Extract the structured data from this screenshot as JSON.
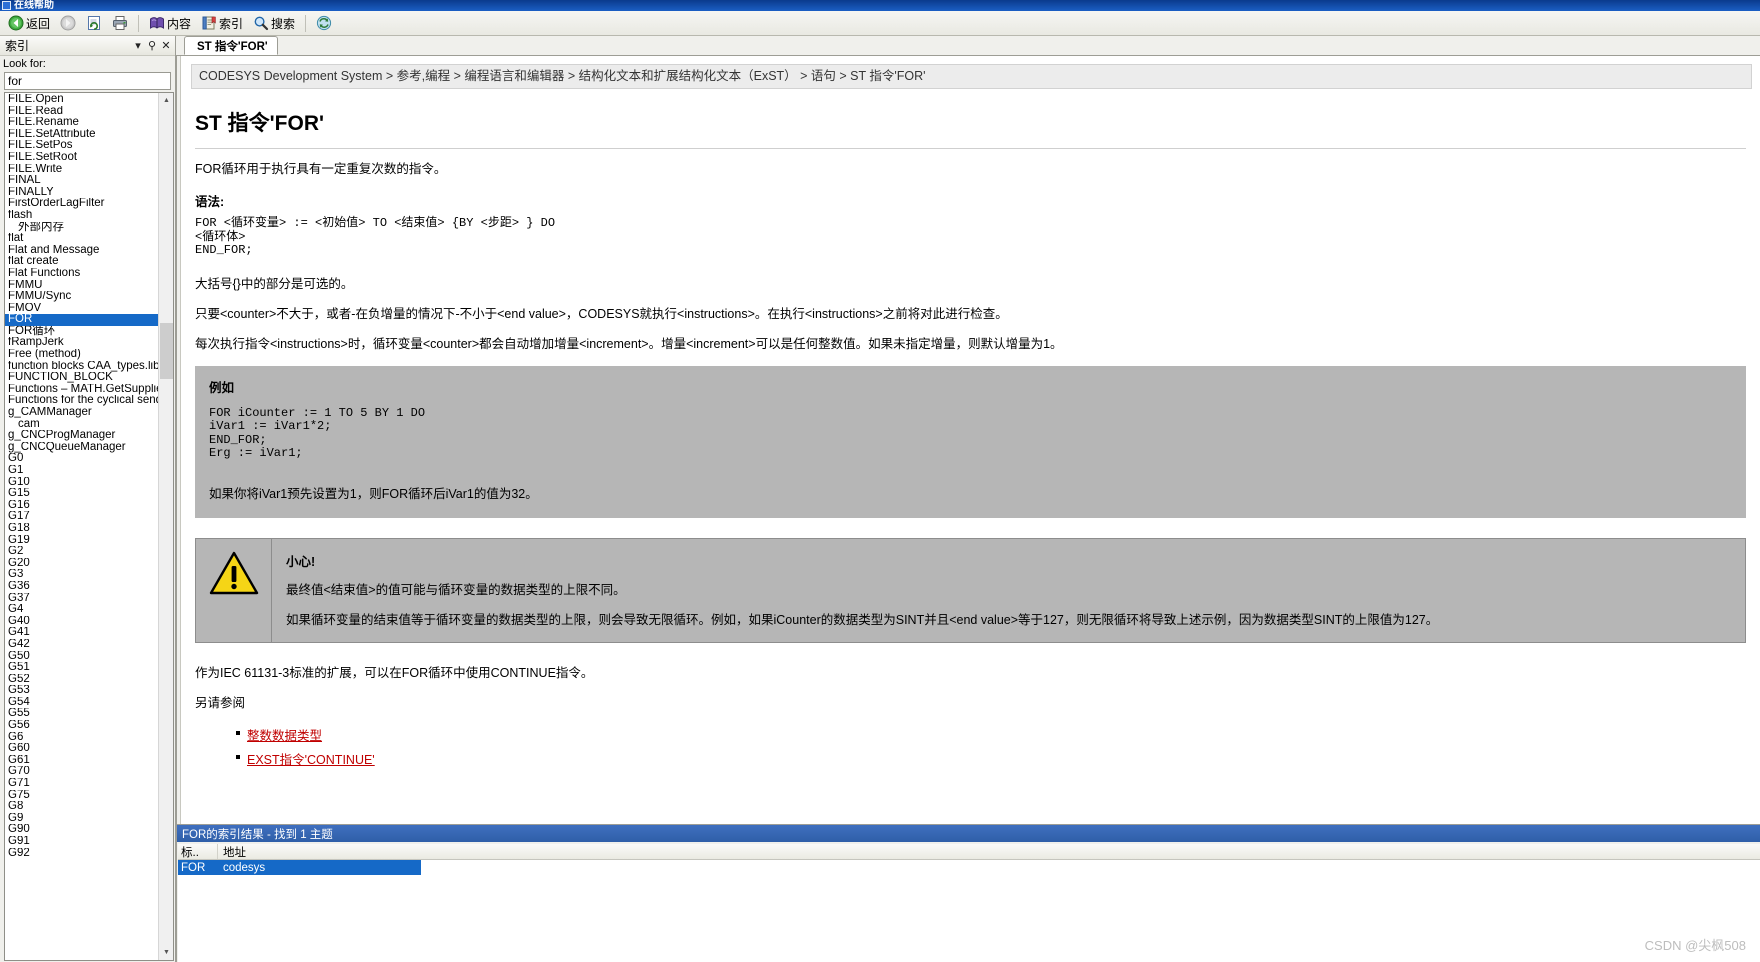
{
  "window": {
    "title": "在线帮助"
  },
  "toolbar": {
    "back_label": "返回",
    "forward_label": "",
    "refresh_label": "",
    "print_label": "",
    "contents_label": "内容",
    "index_label": "索引",
    "search_label": "搜索",
    "sync_label": "",
    "icons": {
      "back": "back-arrow-icon",
      "forward": "forward-arrow-icon",
      "refresh": "refresh-page-icon",
      "print": "printer-icon",
      "contents": "book-contents-icon",
      "index": "index-book-icon",
      "search": "magnifier-icon",
      "sync": "sync-toc-icon"
    }
  },
  "sidebar": {
    "header_title": "索引",
    "header_dropdown": "▾",
    "header_pin": "⚲",
    "header_close": "✕",
    "lookfor_label": "Look for:",
    "lookfor_value": "for",
    "lookfor_placeholder": "",
    "selected_index": 16,
    "items": [
      {
        "label": "FILE.Open",
        "indent": false
      },
      {
        "label": "FILE.Read",
        "indent": false
      },
      {
        "label": "FILE.Rename",
        "indent": false
      },
      {
        "label": "FILE.SetAttribute",
        "indent": false
      },
      {
        "label": "FILE.SetPos",
        "indent": false
      },
      {
        "label": "FILE.SetRoot",
        "indent": false
      },
      {
        "label": "FILE.Write",
        "indent": false
      },
      {
        "label": "FINAL",
        "indent": false
      },
      {
        "label": "FINALLY",
        "indent": false
      },
      {
        "label": "FirstOrderLagFilter",
        "indent": false
      },
      {
        "label": "flash",
        "indent": false
      },
      {
        "label": "外部内存",
        "indent": true
      },
      {
        "label": "flat",
        "indent": false
      },
      {
        "label": "Flat and Message",
        "indent": false
      },
      {
        "label": "flat create",
        "indent": false
      },
      {
        "label": "Flat Functions",
        "indent": false
      },
      {
        "label": "FMMU",
        "indent": false
      },
      {
        "label": "FMMU/Sync",
        "indent": false
      },
      {
        "label": "FMOV",
        "indent": false
      },
      {
        "label": "FOR",
        "indent": false
      },
      {
        "label": "FOR循环",
        "indent": false
      },
      {
        "label": "fRampJerk",
        "indent": false
      },
      {
        "label": "Free (method)",
        "indent": false
      },
      {
        "label": "function blocks CAA_types.library",
        "indent": false
      },
      {
        "label": "FUNCTION_BLOCK",
        "indent": false
      },
      {
        "label": "Functions – MATH.GetSupplierVersion",
        "indent": false
      },
      {
        "label": "Functions for the cyclical sending of m",
        "indent": false
      },
      {
        "label": "g_CAMManager",
        "indent": false
      },
      {
        "label": "cam",
        "indent": true
      },
      {
        "label": "g_CNCProgManager",
        "indent": false
      },
      {
        "label": "g_CNCQueueManager",
        "indent": false
      },
      {
        "label": "G0",
        "indent": false
      },
      {
        "label": "G1",
        "indent": false
      },
      {
        "label": "G10",
        "indent": false
      },
      {
        "label": "G15",
        "indent": false
      },
      {
        "label": "G16",
        "indent": false
      },
      {
        "label": "G17",
        "indent": false
      },
      {
        "label": "G18",
        "indent": false
      },
      {
        "label": "G19",
        "indent": false
      },
      {
        "label": "G2",
        "indent": false
      },
      {
        "label": "G20",
        "indent": false
      },
      {
        "label": "G3",
        "indent": false
      },
      {
        "label": "G36",
        "indent": false
      },
      {
        "label": "G37",
        "indent": false
      },
      {
        "label": "G4",
        "indent": false
      },
      {
        "label": "G40",
        "indent": false
      },
      {
        "label": "G41",
        "indent": false
      },
      {
        "label": "G42",
        "indent": false
      },
      {
        "label": "G50",
        "indent": false
      },
      {
        "label": "G51",
        "indent": false
      },
      {
        "label": "G52",
        "indent": false
      },
      {
        "label": "G53",
        "indent": false
      },
      {
        "label": "G54",
        "indent": false
      },
      {
        "label": "G55",
        "indent": false
      },
      {
        "label": "G56",
        "indent": false
      },
      {
        "label": "G6",
        "indent": false
      },
      {
        "label": "G60",
        "indent": false
      },
      {
        "label": "G61",
        "indent": false
      },
      {
        "label": "G70",
        "indent": false
      },
      {
        "label": "G71",
        "indent": false
      },
      {
        "label": "G75",
        "indent": false
      },
      {
        "label": "G8",
        "indent": false
      },
      {
        "label": "G9",
        "indent": false
      },
      {
        "label": "G90",
        "indent": false
      },
      {
        "label": "G91",
        "indent": false
      },
      {
        "label": "G92",
        "indent": false
      }
    ]
  },
  "tab": {
    "label": "ST 指令'FOR'"
  },
  "document": {
    "breadcrumb": "CODESYS Development System > 参考,编程 > 编程语言和编辑器 > 结构化文本和扩展结构化文本（ExST） > 语句 > ST 指令'FOR'",
    "title": "ST 指令'FOR'",
    "intro": "FOR循环用于执行具有一定重复次数的指令。",
    "syntax_label": "语法:",
    "syntax_code": "FOR <循环变量> := <初始值> TO <结束值> {BY <步距> } DO\n<循环体>\nEND_FOR;",
    "para_braces": "大括号{}中的部分是可选的。",
    "para_counter": "只要<counter>不大于，或者-在负增量的情况下-不小于<end value>，CODESYS就执行<instructions>。在执行<instructions>之前将对此进行检查。",
    "para_increment": "每次执行指令<instructions>时，循环变量<counter>都会自动增加增量<increment>。增量<increment>可以是任何整数值。如果未指定增量，则默认增量为1。",
    "example": {
      "title": "例如",
      "code": "FOR iCounter := 1 TO 5 BY 1 DO\niVar1 := iVar1*2;\nEND_FOR;\nErg := iVar1;",
      "note": "如果你将iVar1预先设置为1，则FOR循环后iVar1的值为32。"
    },
    "warning": {
      "icon": "warning-triangle-icon",
      "title": "小心!",
      "line1": "最终值<结束值>的值可能与循环变量的数据类型的上限不同。",
      "line2": "如果循环变量的结束值等于循环变量的数据类型的上限，则会导致无限循环。例如，如果iCounter的数据类型为SINT并且<end value>等于127，则无限循环将导致上述示例，因为数据类型SINT的上限值为127。"
    },
    "para_continue": "作为IEC 61131-3标准的扩展，可以在FOR循环中使用CONTINUE指令。",
    "seealso_label": "另请参阅",
    "seealso_links": [
      "整数数据类型",
      "EXST指令'CONTINUE'"
    ]
  },
  "results": {
    "title": "FOR的索引结果 - 找到 1 主题",
    "columns": [
      "标..",
      "地址"
    ],
    "rows": [
      {
        "title": "FOR",
        "location": "codesys",
        "selected": true
      }
    ]
  },
  "watermark": "CSDN @尖枫508",
  "colors": {
    "selection_blue": "#1569c7",
    "titlebar_blue": "#0a3a8c",
    "results_header": "#3f6fbf",
    "link_red": "#c00000",
    "box_gray": "#b6b6b6"
  }
}
